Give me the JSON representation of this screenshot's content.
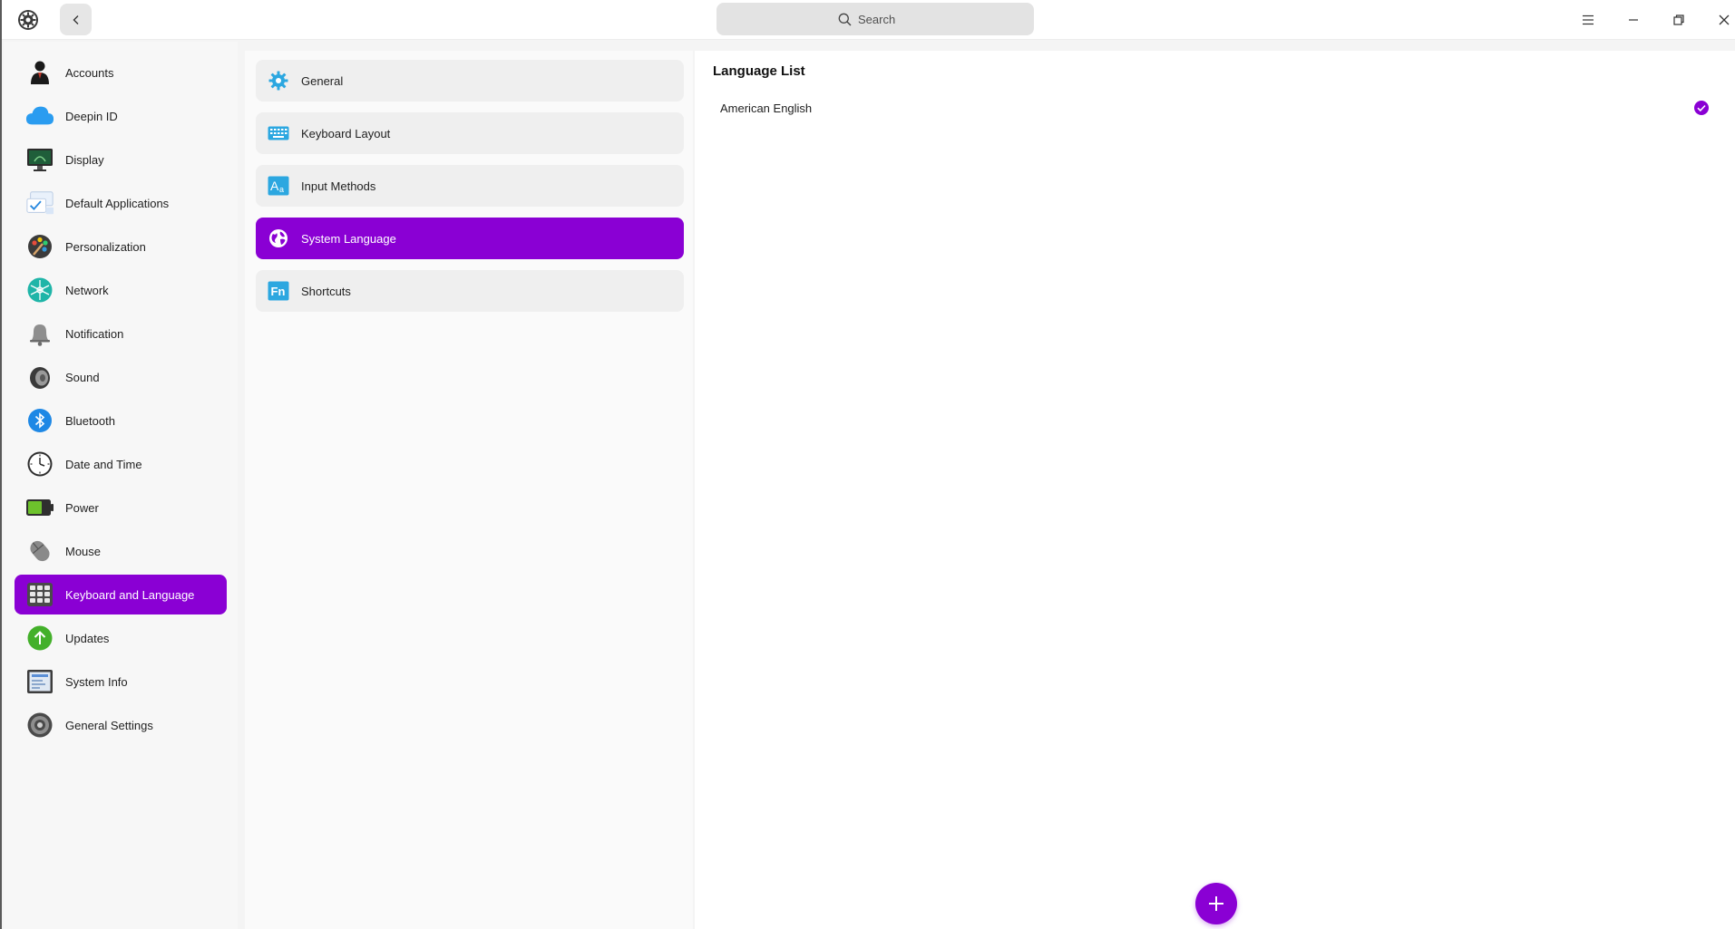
{
  "header": {
    "search_placeholder": "Search"
  },
  "sidebar": {
    "items": [
      {
        "label": "Accounts",
        "icon": "accounts-icon"
      },
      {
        "label": "Deepin ID",
        "icon": "cloud-icon"
      },
      {
        "label": "Display",
        "icon": "monitor-icon"
      },
      {
        "label": "Default Applications",
        "icon": "default-apps-icon"
      },
      {
        "label": "Personalization",
        "icon": "palette-icon"
      },
      {
        "label": "Network",
        "icon": "network-icon"
      },
      {
        "label": "Notification",
        "icon": "bell-icon"
      },
      {
        "label": "Sound",
        "icon": "speaker-icon"
      },
      {
        "label": "Bluetooth",
        "icon": "bluetooth-icon"
      },
      {
        "label": "Date and Time",
        "icon": "clock-icon"
      },
      {
        "label": "Power",
        "icon": "battery-icon"
      },
      {
        "label": "Mouse",
        "icon": "mouse-icon"
      },
      {
        "label": "Keyboard and Language",
        "icon": "keyboard-icon",
        "active": true
      },
      {
        "label": "Updates",
        "icon": "update-arrow-icon"
      },
      {
        "label": "System Info",
        "icon": "system-info-icon"
      },
      {
        "label": "General Settings",
        "icon": "gear-disc-icon"
      }
    ]
  },
  "subnav": {
    "items": [
      {
        "label": "General",
        "icon": "gear-icon"
      },
      {
        "label": "Keyboard Layout",
        "icon": "keyboard-layout-icon"
      },
      {
        "label": "Input Methods",
        "icon": "input-methods-icon"
      },
      {
        "label": "System Language",
        "icon": "globe-icon",
        "active": true
      },
      {
        "label": "Shortcuts",
        "icon": "fn-key-icon"
      }
    ]
  },
  "content": {
    "title": "Language List",
    "languages": [
      {
        "name": "American English",
        "selected": true
      }
    ]
  },
  "colors": {
    "accent": "#8a00d4",
    "icon_blue": "#2ca7e0"
  }
}
